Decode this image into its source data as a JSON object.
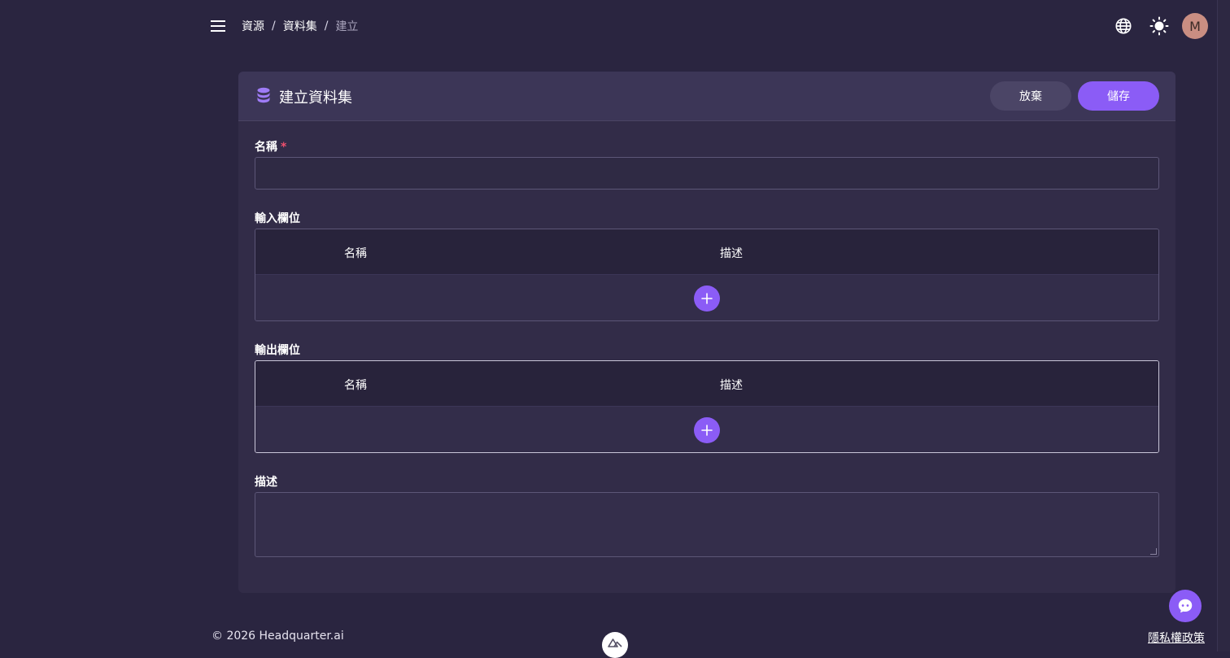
{
  "breadcrumb": {
    "items": [
      "資源",
      "資料集"
    ],
    "separator": "/",
    "current": "建立"
  },
  "header_icons": {
    "language": "globe-icon",
    "theme": "sun-icon",
    "avatar_initial": "M"
  },
  "card": {
    "title": "建立資料集",
    "title_icon": "database-icon",
    "cancel_label": "放棄",
    "save_label": "儲存"
  },
  "form": {
    "name_label": "名稱",
    "required_mark": "*",
    "name_value": "",
    "input_fields": {
      "label": "輸入欄位",
      "columns": [
        "名稱",
        "描述"
      ]
    },
    "output_fields": {
      "label": "輸出欄位",
      "columns": [
        "名稱",
        "描述"
      ]
    },
    "description_label": "描述",
    "description_value": ""
  },
  "footer": {
    "copyright": "© 2026 Headquarter.ai",
    "privacy_link": "隱私權政策"
  },
  "colors": {
    "background": "#2a2540",
    "card": "#322c48",
    "accent": "#8b5cf6",
    "required": "#f0506e"
  }
}
